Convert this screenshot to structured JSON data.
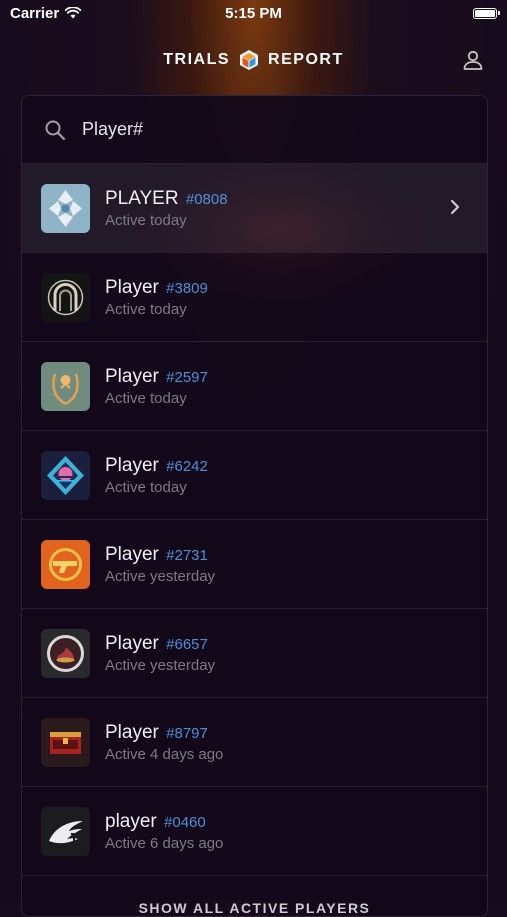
{
  "status_bar": {
    "carrier": "Carrier",
    "time": "5:15 PM"
  },
  "header": {
    "logo_left": "TRIALS",
    "logo_right": "REPORT"
  },
  "search": {
    "value": "Player#"
  },
  "results": [
    {
      "name": "PLAYER",
      "code": "#0808",
      "activity": "Active today",
      "emblem": "ghost-shell-emblem",
      "selected": true
    },
    {
      "name": "Player",
      "code": "#3809",
      "activity": "Active today",
      "emblem": "arch-emblem"
    },
    {
      "name": "Player",
      "code": "#2597",
      "activity": "Active today",
      "emblem": "laurel-emblem"
    },
    {
      "name": "Player",
      "code": "#6242",
      "activity": "Active today",
      "emblem": "diamond-sunset-emblem"
    },
    {
      "name": "Player",
      "code": "#2731",
      "activity": "Active yesterday",
      "emblem": "hand-cannon-emblem"
    },
    {
      "name": "Player",
      "code": "#6657",
      "activity": "Active yesterday",
      "emblem": "ring-flame-emblem"
    },
    {
      "name": "Player",
      "code": "#8797",
      "activity": "Active 4 days ago",
      "emblem": "chest-emblem"
    },
    {
      "name": "player",
      "code": "#0460",
      "activity": "Active 6 days ago",
      "emblem": "wing-emblem"
    }
  ],
  "footer": {
    "show_all_label": "SHOW ALL ACTIVE PLAYERS"
  },
  "colors": {
    "accent_code": "#4f8fd8",
    "panel_bg": "#12081a",
    "muted_text": "#7f7889"
  }
}
